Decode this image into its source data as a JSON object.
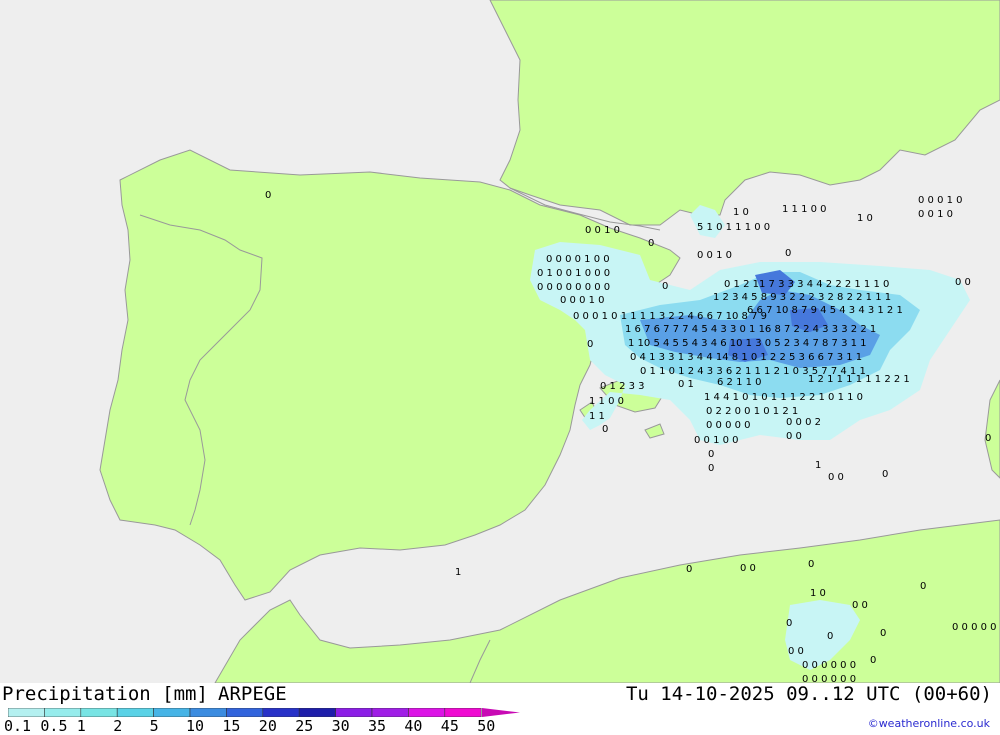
{
  "title": "Precipitation [mm]",
  "model": "ARPEGE",
  "valid_time": "Tu 14-10-2025 09..12 UTC (00+60)",
  "credit": "©weatheronline.co.uk",
  "legend": {
    "labels": [
      "0.1",
      "0.5",
      "1",
      "2",
      "5",
      "10",
      "15",
      "20",
      "25",
      "30",
      "35",
      "40",
      "45",
      "50"
    ],
    "colors": [
      "#b4f0f0",
      "#96ecec",
      "#78e4e4",
      "#5ad2e6",
      "#46b4e6",
      "#3c8ce0",
      "#3264dc",
      "#2832c8",
      "#1e1eaa",
      "#8c1ee6",
      "#a01ee6",
      "#dc14e6",
      "#f00ad2",
      "#c80ab4"
    ]
  },
  "colors": {
    "sea": "#eeeeee",
    "land": "#ccff99",
    "border": "#999999",
    "precip_light": "#c8f5f5",
    "precip_mid": "#8cdcf0",
    "precip_heavy": "#5aa0e6",
    "precip_core": "#4678dc"
  },
  "map_labels": [
    "0",
    "1 0",
    "1 1 1 0 0",
    "5 1 0 1 1 1 0 0",
    "0 0 1 0",
    "0 0 0 1 0",
    "0 0 1 0",
    "0 0 0 0 1 0 0",
    "0 1 0 0 1 0 0 0",
    "0 0 0 0 0 0 0 0",
    "0 0 0 1 0",
    "0 1 2 11 7 3 3 3 4 4 2 2 2 1 1 1 0",
    "1 2 3 4 5 8 9 3 2 2 2 3 2 8 2 2 1 1 1",
    "6 6 7 10 8 7 9 4 5 4 3 4 3 1 2 1",
    "0 0 0 1 0 1 1 1 1 3 2 2 4 6 6 7 10 8 7 9",
    "1 6 7 6 7 7 7 4 5 4 3 3 0 1 16 8 7 2 2 4 3 3 3 2 2 1",
    "1 10 5 4 5 5 4 3 4 6 10 1 3 0 5 2 3 4 7 8 7 3 1 1",
    "0 4 1 3 3 1 3 4 4 14 8 1 0 1 2 2 5 3 6 6 7 3 1 1",
    "0 1 1 0 1 2 4 3 3 6 2 1 1 1 2 1 0 3 5 7 7 4 1 1",
    "0 1 2 3 3",
    "0 1",
    "6 2 1 1 0",
    "1 2 1 1 1 1 1 1 2 2 1",
    "1 1 0 0",
    "1 4 4 1 0 1 0 1 1 1 2 2 1 0 1 1 0",
    "1 1",
    "0 2 2 0 0 1 0 1 2 1",
    "0",
    "0 0 0 0 0",
    "0 0 0 2",
    "0 0 1 0 0",
    "0 0",
    "0",
    "0",
    "0 0",
    "0",
    "1",
    "0",
    "0 0",
    "0",
    "1 0",
    "0",
    "0 0",
    "0",
    "0 0 0 0 0 0",
    "0",
    "0",
    "0 0",
    "0 0 0 0 0 0",
    "0 0 0 0 0 0",
    "0",
    "1 0",
    "0 0 1 0",
    "0",
    "0",
    "0 0",
    "0",
    "0",
    "1",
    "0"
  ]
}
